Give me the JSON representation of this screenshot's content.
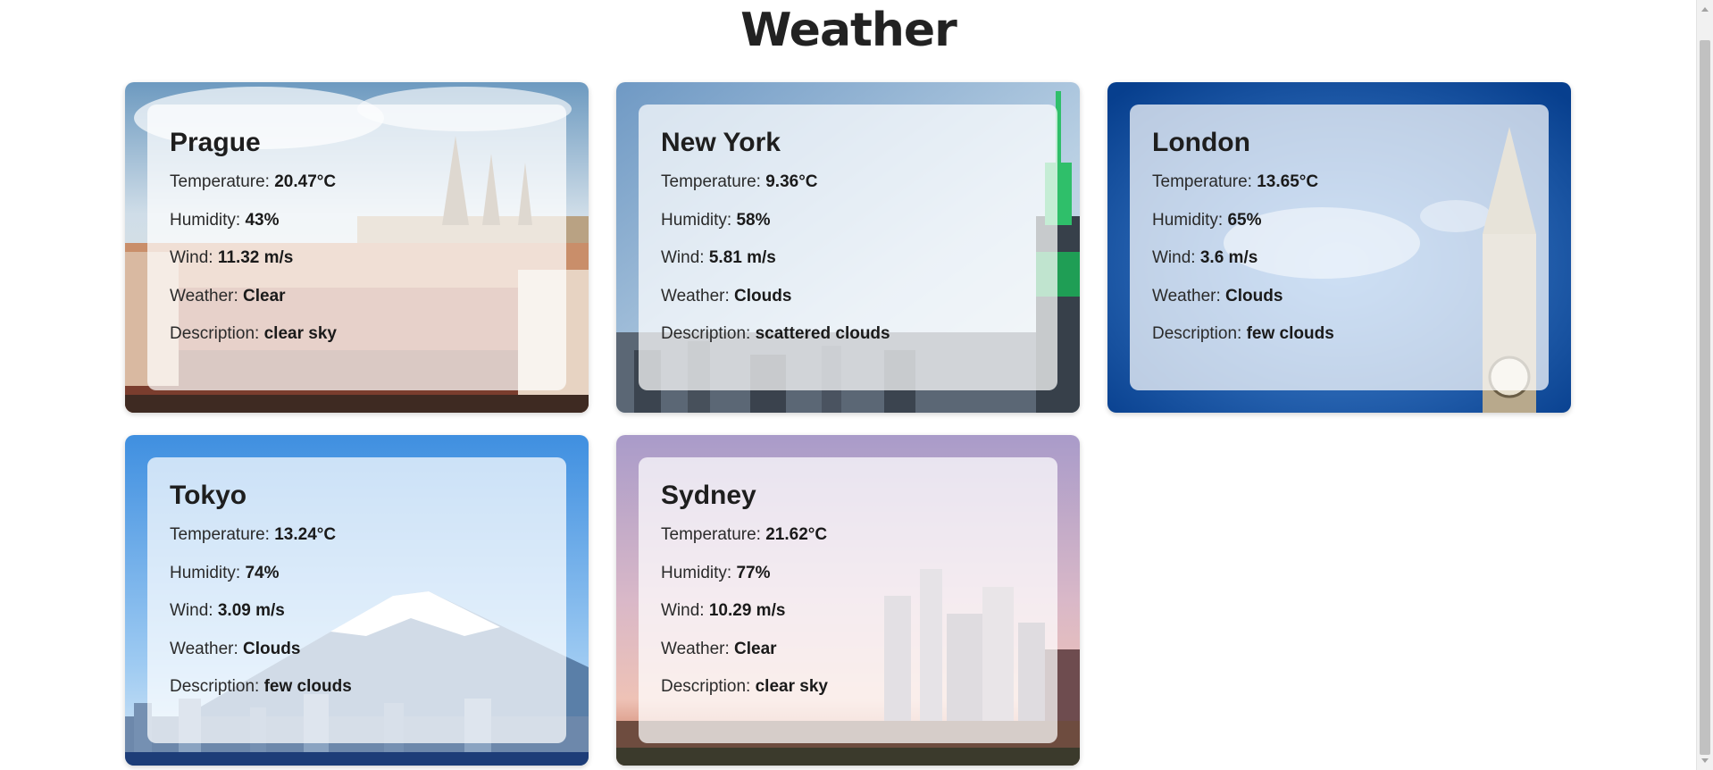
{
  "page": {
    "title": "Weather"
  },
  "labels": {
    "temperature": "Temperature:",
    "humidity": "Humidity:",
    "wind": "Wind:",
    "weather": "Weather:",
    "description": "Description:"
  },
  "cities": [
    {
      "name": "Prague",
      "temperature": "20.47°C",
      "humidity": "43%",
      "wind": "11.32 m/s",
      "weather": "Clear",
      "description": "clear sky",
      "background": "prague-castle-cityscape"
    },
    {
      "name": "New York",
      "temperature": "9.36°C",
      "humidity": "58%",
      "wind": "5.81 m/s",
      "weather": "Clouds",
      "description": "scattered clouds",
      "background": "empire-state-skyline"
    },
    {
      "name": "London",
      "temperature": "13.65°C",
      "humidity": "65%",
      "wind": "3.6 m/s",
      "weather": "Clouds",
      "description": "few clouds",
      "background": "big-ben-blue-sky"
    },
    {
      "name": "Tokyo",
      "temperature": "13.24°C",
      "humidity": "74%",
      "wind": "3.09 m/s",
      "weather": "Clouds",
      "description": "few clouds",
      "background": "mount-fuji-city"
    },
    {
      "name": "Sydney",
      "temperature": "21.62°C",
      "humidity": "77%",
      "wind": "10.29 m/s",
      "weather": "Clear",
      "description": "clear sky",
      "background": "sydney-skyline-sunset"
    }
  ],
  "colors": {
    "panel": "#ffffffb8",
    "heading": "#222222"
  }
}
